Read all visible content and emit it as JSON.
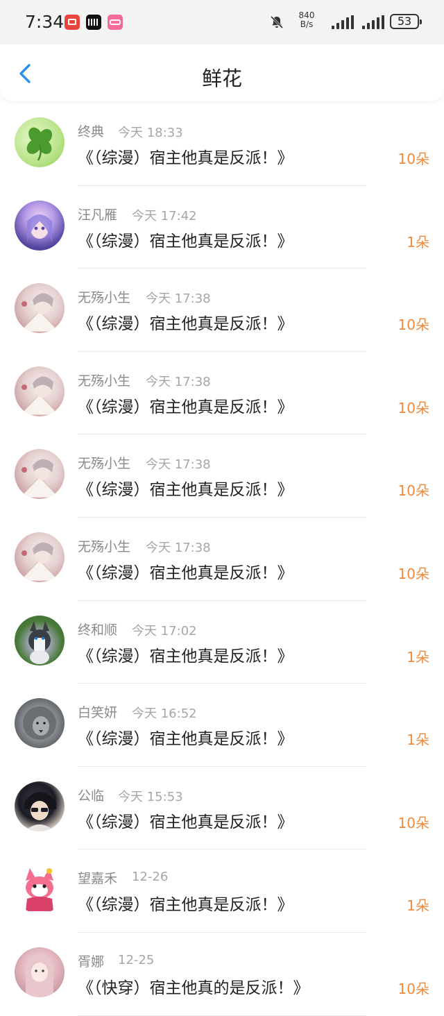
{
  "status_bar": {
    "time": "7:34",
    "app_icons": [
      "news-app-icon",
      "barcode-app-icon",
      "bilibili-app-icon"
    ],
    "net_speed_value": "840",
    "net_speed_unit": "B/s",
    "battery": "53"
  },
  "header": {
    "title": "鲜花",
    "back_icon": "chevron-left-icon"
  },
  "colors": {
    "accent_blue": "#2b8ff0",
    "count_orange": "#ef8a3c",
    "meta_gray": "#8a8a8a"
  },
  "rows": [
    {
      "name": "终典",
      "time": "今天 18:33",
      "book": "《（综漫）宿主他真是反派！》",
      "count": "10朵",
      "avatar": "clover-avatar"
    },
    {
      "name": "汪凡雁",
      "time": "今天 17:42",
      "book": "《（综漫）宿主他真是反派！》",
      "count": "1朵",
      "avatar": "anime-girl-avatar"
    },
    {
      "name": "无殇小生",
      "time": "今天 17:38",
      "book": "《（综漫）宿主他真是反派！》",
      "count": "10朵",
      "avatar": "fan-character-avatar"
    },
    {
      "name": "无殇小生",
      "time": "今天 17:38",
      "book": "《（综漫）宿主他真是反派！》",
      "count": "10朵",
      "avatar": "fan-character-avatar"
    },
    {
      "name": "无殇小生",
      "time": "今天 17:38",
      "book": "《（综漫）宿主他真是反派！》",
      "count": "10朵",
      "avatar": "fan-character-avatar"
    },
    {
      "name": "无殇小生",
      "time": "今天 17:38",
      "book": "《（综漫）宿主他真是反派！》",
      "count": "10朵",
      "avatar": "fan-character-avatar"
    },
    {
      "name": "终和顺",
      "time": "今天 17:02",
      "book": "《（综漫）宿主他真是反派！》",
      "count": "1朵",
      "avatar": "husky-avatar"
    },
    {
      "name": "白笑妍",
      "time": "今天 16:52",
      "book": "《（综漫）宿主他真是反派！》",
      "count": "1朵",
      "avatar": "lion-avatar"
    },
    {
      "name": "公临",
      "time": "今天 15:53",
      "book": "《（综漫）宿主他真是反派！》",
      "count": "10朵",
      "avatar": "sunglasses-guy-avatar"
    },
    {
      "name": "望嘉禾",
      "time": "12-26",
      "book": "《（综漫）宿主他真是反派！》",
      "count": "1朵",
      "avatar": "cartoon-fox-avatar"
    },
    {
      "name": "胥娜",
      "time": "12-25",
      "book": "《（快穿）宿主他真的是反派！》",
      "count": "10朵",
      "avatar": "girl-avatar"
    }
  ]
}
